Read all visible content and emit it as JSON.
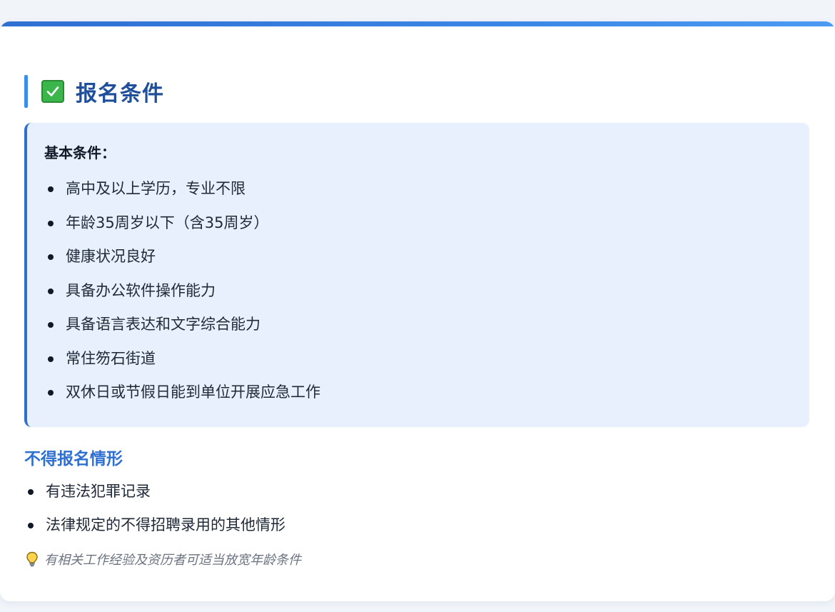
{
  "section": {
    "title": "报名条件",
    "icon": "check-box-icon"
  },
  "basic": {
    "heading": "基本条件：",
    "items": [
      "高中及以上学历，专业不限",
      "年龄35周岁以下（含35周岁）",
      "健康状况良好",
      "具备办公软件操作能力",
      "具备语言表达和文字综合能力",
      "常住笏石街道",
      "双休日或节假日能到单位开展应急工作"
    ]
  },
  "exclusions": {
    "heading": "不得报名情形",
    "items": [
      "有违法犯罪记录",
      "法律规定的不得招聘录用的其他情形"
    ]
  },
  "note": {
    "icon": "lightbulb-icon",
    "text": "有相关工作经验及资历者可适当放宽年龄条件"
  },
  "colors": {
    "accent": "#2f6fd1",
    "title": "#1f4f9a",
    "box_background": "#e8f0fd",
    "check": "#3bb64a"
  }
}
